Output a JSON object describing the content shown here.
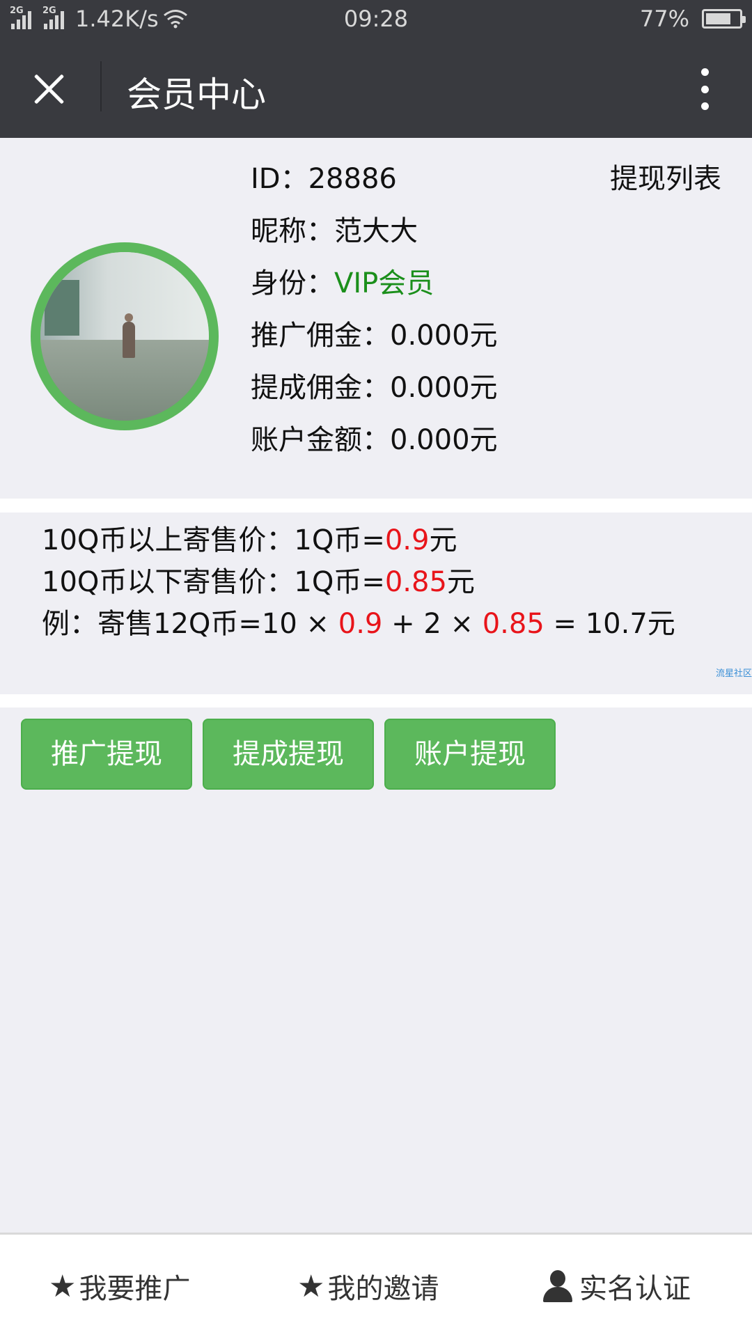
{
  "status_bar": {
    "network1": "2G",
    "network2": "2G",
    "speed": "1.42K/s",
    "time": "09:28",
    "battery": "77%",
    "battery_level": 0.77
  },
  "header": {
    "title": "会员中心"
  },
  "profile": {
    "id_label": "ID：",
    "id_value": "28886",
    "nickname_label": "昵称：",
    "nickname_value": "范大大",
    "identity_label": "身份：",
    "identity_value": "VIP会员",
    "promo_commission_label": "推广佣金：",
    "promo_commission_value": "0.000元",
    "bonus_commission_label": "提成佣金：",
    "bonus_commission_value": "0.000元",
    "account_balance_label": "账户金额：",
    "account_balance_value": "0.000元",
    "withdraw_list_link": "提现列表"
  },
  "pricing": {
    "line1_prefix": "10Q币以上寄售价：1Q币=",
    "line1_price": "0.9",
    "line1_suffix": "元",
    "line2_prefix": "10Q币以下寄售价：1Q币=",
    "line2_price": "0.85",
    "line2_suffix": "元",
    "example_prefix": "例：寄售12Q币=10 × ",
    "example_price1": "0.9",
    "example_mid": " + 2 × ",
    "example_price2": "0.85",
    "example_suffix": " = 10.7元",
    "watermark": "流星社区"
  },
  "actions": {
    "promo_withdraw": "推广提现",
    "bonus_withdraw": "提成提现",
    "account_withdraw": "账户提现"
  },
  "bottom_nav": {
    "promote": "我要推广",
    "invitations": "我的邀请",
    "verification": "实名认证",
    "star_icon": "★"
  },
  "colors": {
    "header_bg": "#393a3f",
    "accent_green": "#5cb85c",
    "vip_green": "#1b8f1b",
    "price_red": "#e8141a",
    "page_bg": "#efeff4"
  }
}
